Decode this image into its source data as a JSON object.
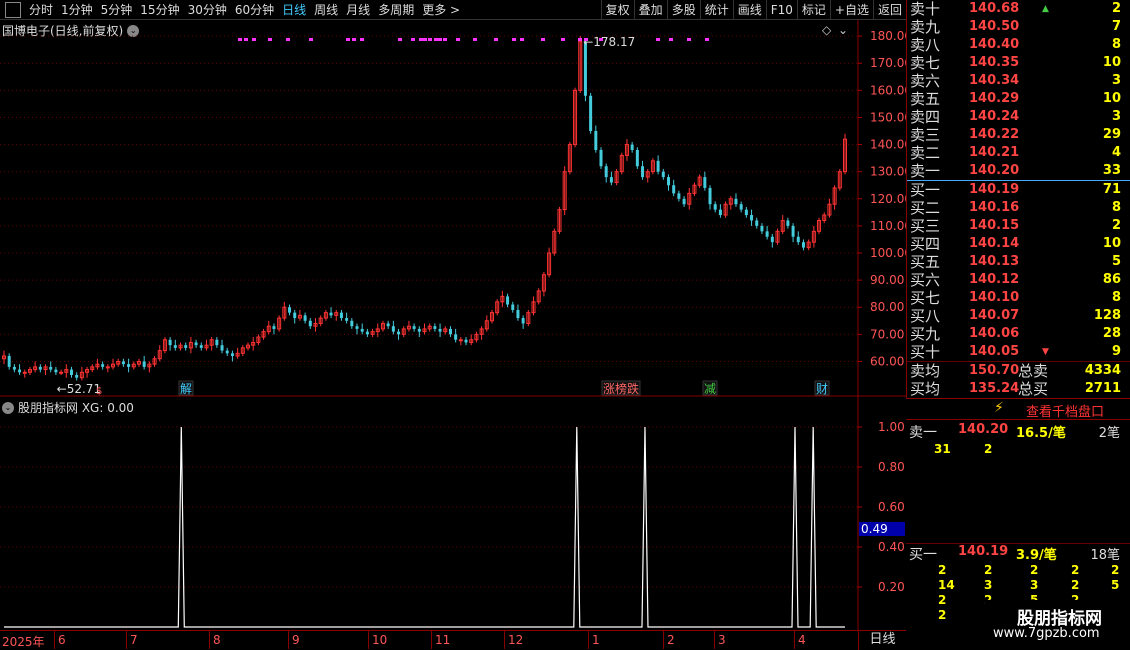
{
  "toolbar": {
    "tabs": [
      "分时",
      "1分钟",
      "5分钟",
      "15分钟",
      "30分钟",
      "60分钟",
      "日线",
      "周线",
      "月线",
      "多周期",
      "更多 >"
    ],
    "active": "日线",
    "right": [
      "复权",
      "叠加",
      "多股",
      "统计",
      "画线",
      "F10",
      "标记",
      "+自选",
      "返回"
    ]
  },
  "price_title": "国博电子(日线,前复权)",
  "indicator_title": "股朋指标网 XG: 0.00",
  "order_book": {
    "asks": [
      {
        "label": "卖十",
        "price": "140.68",
        "vol": "2",
        "mark": "up"
      },
      {
        "label": "卖九",
        "price": "140.50",
        "vol": "7"
      },
      {
        "label": "卖八",
        "price": "140.40",
        "vol": "8"
      },
      {
        "label": "卖七",
        "price": "140.35",
        "vol": "10"
      },
      {
        "label": "卖六",
        "price": "140.34",
        "vol": "3"
      },
      {
        "label": "卖五",
        "price": "140.29",
        "vol": "10"
      },
      {
        "label": "卖四",
        "price": "140.24",
        "vol": "3"
      },
      {
        "label": "卖三",
        "price": "140.22",
        "vol": "29"
      },
      {
        "label": "卖二",
        "price": "140.21",
        "vol": "4"
      },
      {
        "label": "卖一",
        "price": "140.20",
        "vol": "33"
      }
    ],
    "bids": [
      {
        "label": "买一",
        "price": "140.19",
        "vol": "71"
      },
      {
        "label": "买二",
        "price": "140.16",
        "vol": "8"
      },
      {
        "label": "买三",
        "price": "140.15",
        "vol": "2"
      },
      {
        "label": "买四",
        "price": "140.14",
        "vol": "10"
      },
      {
        "label": "买五",
        "price": "140.13",
        "vol": "5"
      },
      {
        "label": "买六",
        "price": "140.12",
        "vol": "86"
      },
      {
        "label": "买七",
        "price": "140.10",
        "vol": "8"
      },
      {
        "label": "买八",
        "price": "140.07",
        "vol": "128"
      },
      {
        "label": "买九",
        "price": "140.06",
        "vol": "28"
      },
      {
        "label": "买十",
        "price": "140.05",
        "vol": "9",
        "mark": "down"
      }
    ],
    "avg_sell_label": "卖均",
    "avg_sell": "150.70",
    "total_sell_label": "总卖",
    "total_sell": "4334",
    "avg_buy_label": "买均",
    "avg_buy": "135.24",
    "total_buy_label": "总买",
    "total_buy": "2711"
  },
  "thousand_btn": "查看千档盘口",
  "queue_sell": {
    "label": "卖一",
    "price": "140.20",
    "per": "16.5/笔",
    "count": "2笔",
    "nums": [
      "31",
      "2"
    ]
  },
  "queue_buy": {
    "label": "买一",
    "price": "140.19",
    "per": "3.9/笔",
    "count": "18笔",
    "rows": [
      [
        "2",
        "2",
        "2",
        "2",
        "2"
      ],
      [
        "14",
        "3",
        "3",
        "2",
        "5"
      ],
      [
        "2",
        "2",
        "5",
        "2",
        ""
      ],
      [
        "2",
        "",
        "",
        "",
        ""
      ]
    ]
  },
  "period_label": "日线",
  "watermark": {
    "name": "股朋指标网",
    "url": "www.7gpzb.com"
  },
  "date_axis": {
    "year": "2025年",
    "months": [
      "6",
      "7",
      "8",
      "9",
      "10",
      "11",
      "12",
      "1",
      "2",
      "3",
      "4"
    ]
  },
  "markers": [
    {
      "text": "解",
      "color": "#4cf"
    },
    {
      "text": "涨榜跌",
      "color": "#f66"
    },
    {
      "text": "减",
      "color": "#4c4"
    },
    {
      "text": "财",
      "color": "#4cf"
    }
  ],
  "chart_data": [
    {
      "type": "candlestick",
      "title": "",
      "ylim": [
        55,
        183
      ],
      "yticks": [
        60,
        70,
        80,
        90,
        100,
        110,
        120,
        130,
        140,
        150,
        160,
        170,
        180
      ],
      "annotations": [
        {
          "text": "178.17",
          "type": "high"
        },
        {
          "text": "52.71",
          "type": "low"
        }
      ],
      "closes": [
        62,
        58,
        57,
        56,
        56,
        57,
        58,
        57,
        58,
        57,
        56,
        56,
        57,
        55,
        54,
        56,
        57,
        58,
        59,
        58,
        58,
        59,
        60,
        59,
        58,
        59,
        60,
        58,
        59,
        61,
        64,
        68,
        66,
        65,
        66,
        65,
        67,
        66,
        65,
        66,
        68,
        66,
        64,
        63,
        62,
        63,
        65,
        66,
        67,
        69,
        71,
        73,
        72,
        76,
        80,
        78,
        76,
        77,
        75,
        73,
        74,
        76,
        78,
        77,
        78,
        76,
        75,
        73,
        72,
        71,
        70,
        71,
        72,
        74,
        73,
        71,
        70,
        72,
        73,
        72,
        71,
        72,
        73,
        72,
        71,
        72,
        70,
        68,
        68,
        67,
        68,
        70,
        72,
        75,
        78,
        82,
        84,
        81,
        79,
        76,
        74,
        78,
        82,
        86,
        92,
        100,
        108,
        116,
        130,
        140,
        160,
        178,
        158,
        145,
        138,
        132,
        128,
        126,
        130,
        136,
        140,
        138,
        132,
        128,
        130,
        134,
        130,
        128,
        125,
        122,
        120,
        118,
        122,
        125,
        128,
        124,
        118,
        116,
        114,
        118,
        120,
        118,
        116,
        114,
        112,
        110,
        108,
        106,
        104,
        108,
        112,
        110,
        106,
        104,
        102,
        104,
        108,
        112,
        114,
        118,
        124,
        130,
        142
      ]
    },
    {
      "type": "line",
      "title": "",
      "ylim": [
        0,
        1.1
      ],
      "yticks": [
        0.2,
        0.4,
        0.6,
        0.8,
        1.0
      ],
      "tick_labels": [
        "0.20",
        "0.40",
        "0.60",
        "0.80",
        "1.00"
      ],
      "current_value_label": "0.49",
      "spikes_at": [
        39,
        126,
        141,
        174,
        178
      ],
      "n": 186
    }
  ]
}
